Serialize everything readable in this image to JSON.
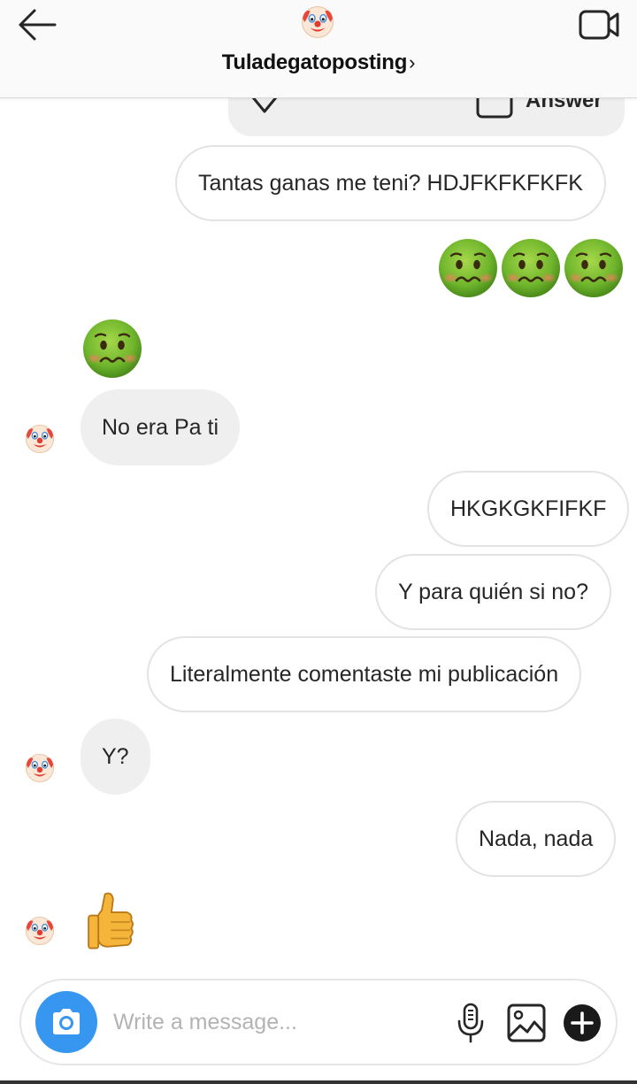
{
  "header": {
    "title": "Tuladegatoposting",
    "chevron": "›",
    "avatar_icon": "clown-face-icon",
    "back_icon": "back-arrow-icon",
    "video_icon": "video-call-icon"
  },
  "story_reply": {
    "answer_label": "Answer"
  },
  "messages": [
    {
      "type": "text",
      "direction": "outgoing",
      "text": "Tantas ganas me teni? HDJFKFKFKFK"
    },
    {
      "type": "emoji",
      "direction": "outgoing",
      "emoji": "nauseated-face-icon",
      "count": 3
    },
    {
      "type": "emoji",
      "direction": "incoming",
      "emoji": "nauseated-face-icon",
      "count": 1
    },
    {
      "type": "text",
      "direction": "incoming",
      "text": "No era Pa ti"
    },
    {
      "type": "text",
      "direction": "outgoing",
      "text": "HKGKGKFIFKF"
    },
    {
      "type": "text",
      "direction": "outgoing",
      "text": "Y para quién si no?"
    },
    {
      "type": "text",
      "direction": "outgoing",
      "text": "Literalmente comentaste mi publicación"
    },
    {
      "type": "text",
      "direction": "incoming",
      "text": "Y?"
    },
    {
      "type": "text",
      "direction": "outgoing",
      "text": "Nada, nada"
    },
    {
      "type": "emoji",
      "direction": "incoming",
      "emoji": "thumbs-up-icon",
      "count": 1
    }
  ],
  "composer": {
    "placeholder": "Write a message...",
    "camera_icon": "camera-icon",
    "mic_icon": "microphone-icon",
    "gallery_icon": "gallery-icon",
    "plus_icon": "plus-circle-icon"
  },
  "colors": {
    "accent": "#3797f0",
    "incoming_bubble": "#efefef",
    "outgoing_border": "#e3e3e3",
    "header_bg": "#fafafa"
  }
}
